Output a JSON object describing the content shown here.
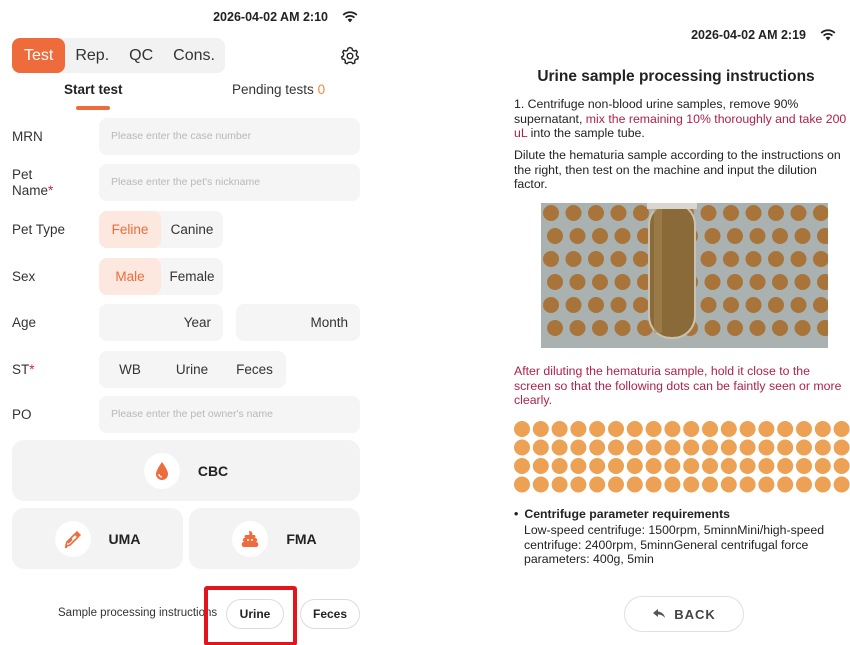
{
  "left": {
    "status": {
      "datetime": "2026-04-02 AM 2:10"
    },
    "tabs": [
      {
        "label": "Test"
      },
      {
        "label": "Rep."
      },
      {
        "label": "QC"
      },
      {
        "label": "Cons."
      }
    ],
    "subtabs": {
      "start": "Start test",
      "pending": "Pending tests",
      "pending_count": "0"
    },
    "form": {
      "mrn": {
        "label": "MRN",
        "placeholder": "Please enter the case number"
      },
      "pet_name": {
        "label": "Pet Name",
        "placeholder": "Please enter the pet's nickname"
      },
      "pet_type": {
        "label": "Pet Type",
        "options": [
          "Feline",
          "Canine"
        ],
        "selected": "Feline"
      },
      "sex": {
        "label": "Sex",
        "options": [
          "Male",
          "Female"
        ],
        "selected": "Male"
      },
      "age": {
        "label": "Age",
        "year": "Year",
        "month": "Month"
      },
      "st": {
        "label": "ST",
        "options": [
          "WB",
          "Urine",
          "Feces"
        ]
      },
      "po": {
        "label": "PO",
        "placeholder": "Please enter the pet owner's name"
      }
    },
    "cards": {
      "cbc": "CBC",
      "uma": "UMA",
      "fma": "FMA"
    },
    "instructions": {
      "label": "Sample processing instructions",
      "urine": "Urine",
      "feces": "Feces"
    }
  },
  "right": {
    "status": {
      "datetime": "2026-04-02 AM 2:19"
    },
    "title": "Urine sample processing instructions",
    "step1_a": "1. Centrifuge non-blood urine samples, remove 90% supernatant, ",
    "step1_b": "mix the remaining 10% thoroughly and take 200 uL",
    "step1_c": " into the sample tube.",
    "dilute": "Dilute the hematuria sample according to the instructions on the right, then test on the machine and input the dilution factor.",
    "after": "After diluting the hematuria sample, hold it close to the screen so that the following dots can be faintly seen or more clearly.",
    "centrifuge_title": "Centrifuge parameter requirements",
    "centrifuge_body": "Low-speed centrifuge: 1500rpm, 5minnMini/high-speed centrifuge: 2400rpm, 5minnGeneral centrifugal force parameters: 400g, 5min",
    "back": "BACK"
  },
  "colors": {
    "accent": "#ee6b3b",
    "highlight": "#e3141b",
    "instruction_red": "#b0204a",
    "dot": "#eca154"
  }
}
